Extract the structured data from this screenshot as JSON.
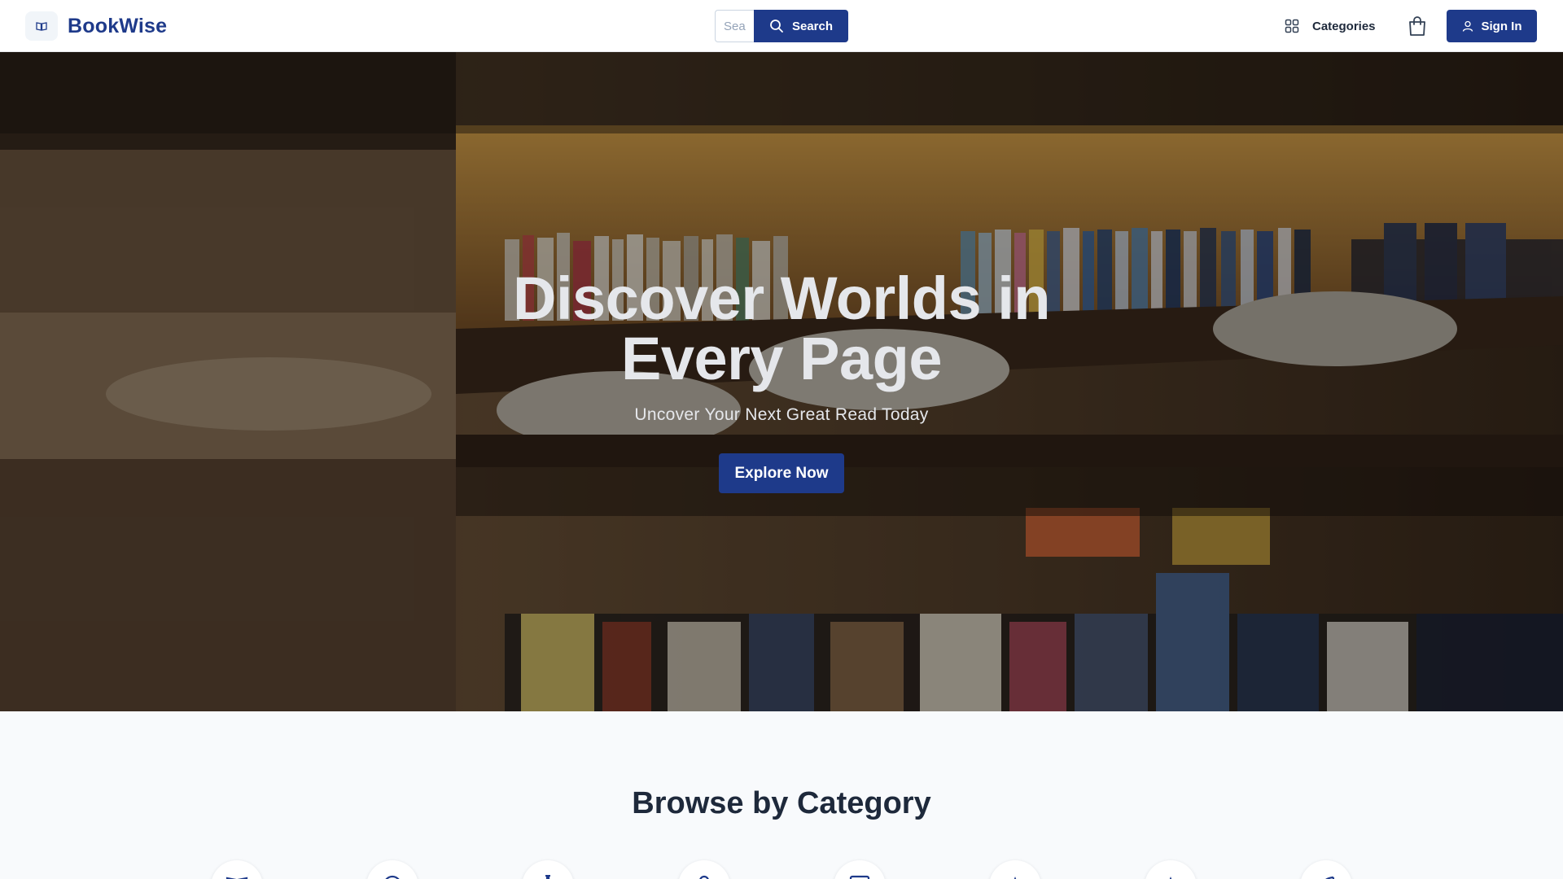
{
  "header": {
    "logo_text": "BookWise",
    "logo_icon": "open-book-icon",
    "search_placeholder": "Search",
    "search_button_label": "Search",
    "categories_label": "Categories",
    "sign_in_label": "Sign In"
  },
  "hero": {
    "title_line1": "Discover Worlds in",
    "title_line2": "Every Page",
    "subtitle": "Uncover Your Next Great Read Today",
    "cta_label": "Explore Now"
  },
  "browse": {
    "title": "Browse by Category",
    "category_icons": [
      "book-icon",
      "globe-icon",
      "flask-icon",
      "user-icon",
      "newspaper-icon",
      "star-icon",
      "compass-icon",
      "rocket-icon"
    ]
  },
  "colors": {
    "brand": "#1e3a8a",
    "page_background": "#f8fafc",
    "heading_text": "#1e293b"
  }
}
